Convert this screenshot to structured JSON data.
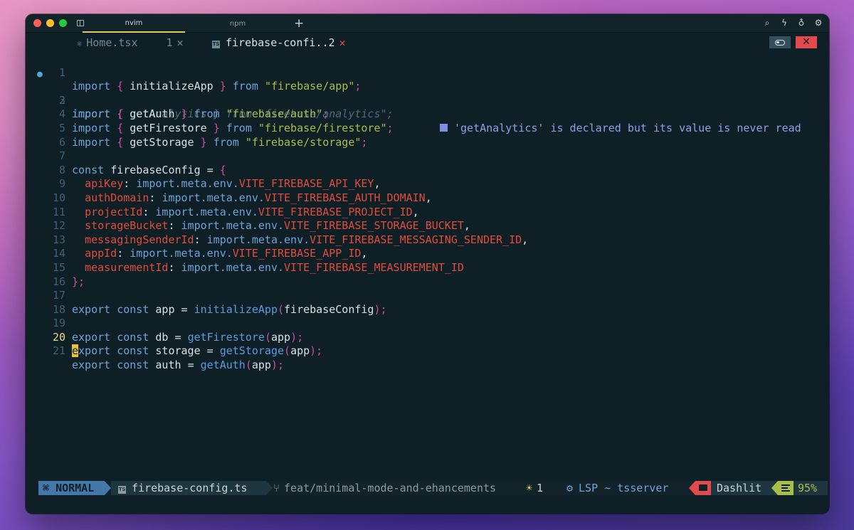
{
  "terminal": {
    "tabs": [
      {
        "label": "nvim",
        "active": true
      },
      {
        "label": "npm",
        "active": false
      }
    ],
    "new_tab_label": "+",
    "toolbar_icons": [
      "search-icon",
      "bolt-icon",
      "lightbulb-icon",
      "gear-icon"
    ]
  },
  "buffers": [
    {
      "name": "Home.tsx",
      "icon": "react-icon",
      "count": "1",
      "close": "✕"
    },
    {
      "name": "firebase-confi..2",
      "icon": "typescript-icon",
      "close": "✕",
      "active": true
    }
  ],
  "buffer_controls": {
    "close": "✕"
  },
  "editor": {
    "current_line": 20,
    "lines": [
      {
        "n": "1"
      },
      {
        "n": "2"
      },
      {
        "n": "3"
      },
      {
        "n": "4"
      },
      {
        "n": "5"
      },
      {
        "n": "6"
      },
      {
        "n": "7"
      },
      {
        "n": "8"
      },
      {
        "n": "9"
      },
      {
        "n": "10"
      },
      {
        "n": "11"
      },
      {
        "n": "12"
      },
      {
        "n": "13"
      },
      {
        "n": "14"
      },
      {
        "n": "15"
      },
      {
        "n": "16"
      },
      {
        "n": "17"
      },
      {
        "n": "18"
      },
      {
        "n": "19"
      },
      {
        "n": "20"
      },
      {
        "n": "21"
      }
    ],
    "code": {
      "l1": [
        "import",
        "{",
        "initializeApp",
        "}",
        "from",
        "\"firebase/app\"",
        ";"
      ],
      "l2": [
        "import { getAnalytics } from \"firebase/analytics\";"
      ],
      "l3": [
        "import",
        "{",
        "getAuth",
        "}",
        "from",
        "\"firebase/auth\"",
        ";"
      ],
      "l4": [
        "import",
        "{",
        "getFirestore",
        "}",
        "from",
        "\"firebase/firestore\"",
        ";"
      ],
      "l5": [
        "import",
        "{",
        "getStorage",
        "}",
        "from",
        "\"firebase/storage\"",
        ";"
      ],
      "l7": [
        "const",
        "firebaseConfig",
        "=",
        "{"
      ],
      "config": [
        {
          "key": "apiKey",
          "val": "VITE_FIREBASE_API_KEY"
        },
        {
          "key": "authDomain",
          "val": "VITE_FIREBASE_AUTH_DOMAIN"
        },
        {
          "key": "projectId",
          "val": "VITE_FIREBASE_PROJECT_ID"
        },
        {
          "key": "storageBucket",
          "val": "VITE_FIREBASE_STORAGE_BUCKET"
        },
        {
          "key": "messagingSenderId",
          "val": "VITE_FIREBASE_MESSAGING_SENDER_ID"
        },
        {
          "key": "appId",
          "val": "VITE_FIREBASE_APP_ID"
        },
        {
          "key": "measurementId",
          "val": "VITE_FIREBASE_MEASUREMENT_ID"
        }
      ],
      "meta_prefix": "import.meta.env.",
      "l15": "};",
      "l17": [
        "export",
        "const",
        "app",
        "=",
        "initializeApp",
        "(",
        "firebaseConfig",
        ");"
      ],
      "l19": [
        "export",
        "const",
        "db",
        "=",
        "getFirestore",
        "(",
        "app",
        ");"
      ],
      "l20": [
        "e",
        "xport",
        "const",
        "storage",
        "=",
        "getStorage",
        "(",
        "app",
        ");"
      ],
      "l21": [
        "export",
        "const",
        "auth",
        "=",
        "getAuth",
        "(",
        "app",
        ");"
      ]
    },
    "diagnostic": "'getAnalytics' is declared but its value is never read"
  },
  "statusline": {
    "mode": "NORMAL",
    "file": "firebase-config.ts",
    "branch": "feat/minimal-mode-and-ehancements",
    "diagnostics": "1",
    "lsp": "LSP ~ tsserver",
    "project": "Dashlit",
    "progress": "95%"
  },
  "colors": {
    "background": "#0f1f26",
    "keyword": "#6fa3d9",
    "string": "#a8bd4a",
    "property": "#e14c3c",
    "punctuation": "#d04c9c",
    "mode": "#4478a8",
    "error": "#e04a4a",
    "cursor": "#e6c23a"
  }
}
